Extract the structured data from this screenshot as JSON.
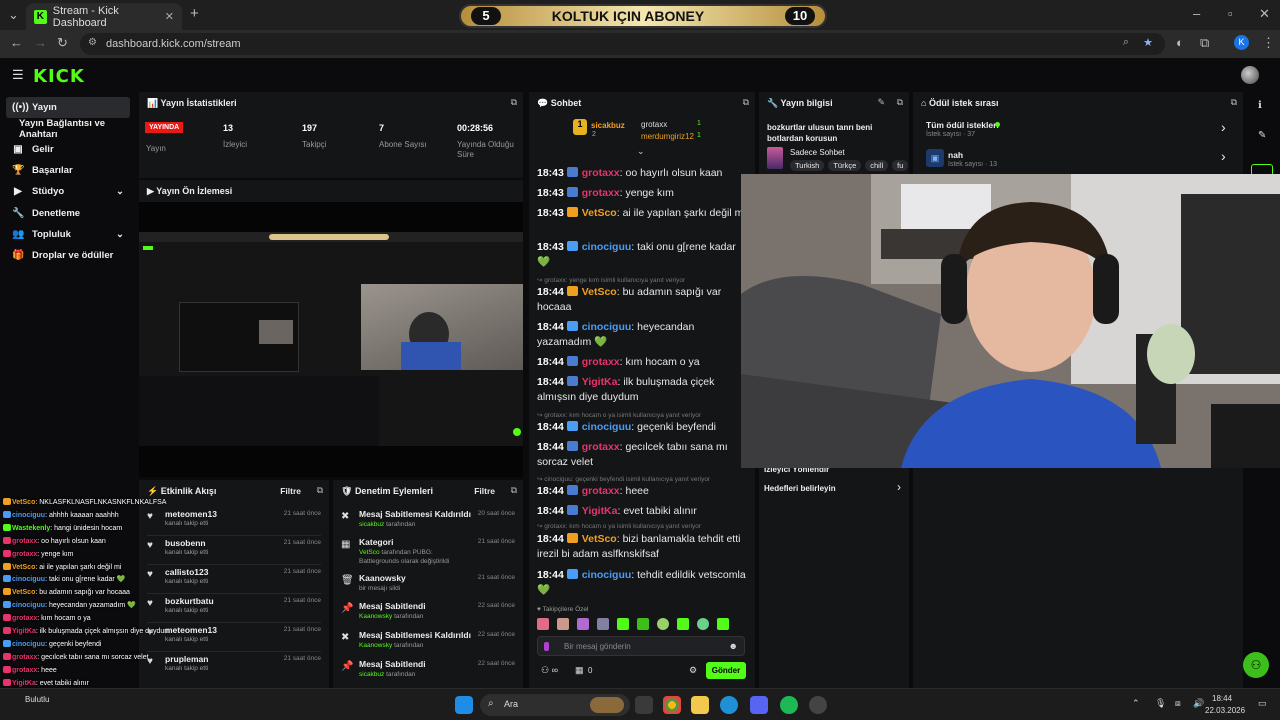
{
  "browser": {
    "tab_title": "Stream - Kick Dashboard",
    "url": "dashboard.kick.com/stream",
    "profile_initial": "K"
  },
  "banner": {
    "left_count": "5",
    "title": "KOLTUK IÇIN ABONEY",
    "right_count": "10"
  },
  "logo": "KICK",
  "sidebar": {
    "items": [
      {
        "label": "Yayın",
        "icon": "broadcast-icon"
      },
      {
        "label": "Yayın Bağlantısı ve Anahtarı",
        "icon": ""
      },
      {
        "label": "Gelir",
        "icon": "revenue-icon"
      },
      {
        "label": "Başarılar",
        "icon": "trophy-icon"
      },
      {
        "label": "Stüdyo",
        "icon": "studio-icon"
      },
      {
        "label": "Denetleme",
        "icon": "wrench-icon"
      },
      {
        "label": "Topluluk",
        "icon": "community-icon"
      },
      {
        "label": "Droplar ve ödüller",
        "icon": "gift-icon"
      }
    ]
  },
  "stats": {
    "title": "Yayın İstatistikleri",
    "live_badge": "YAYINDA",
    "live_label": "Yayın",
    "viewers": "13",
    "viewers_label": "İzleyici",
    "followers": "197",
    "followers_label": "Takipçi",
    "subs": "7",
    "subs_label": "Abone Sayısı",
    "duration": "00:28:56",
    "duration_label": "Yayında Olduğu Süre"
  },
  "preview": {
    "title": "Yayın Ön İzlemesi"
  },
  "activity": {
    "title": "Etkinlik Akışı",
    "filter": "Filtre",
    "items": [
      {
        "name": "meteomen13",
        "sub": "kanalı takip etti",
        "time": "21 saat önce"
      },
      {
        "name": "busobenn",
        "sub": "kanalı takip etti",
        "time": "21 saat önce"
      },
      {
        "name": "callisto123",
        "sub": "kanalı takip etti",
        "time": "21 saat önce"
      },
      {
        "name": "bozkurtbatu",
        "sub": "kanalı takip etti",
        "time": "21 saat önce"
      },
      {
        "name": "meteomen13",
        "sub": "kanalı takip etti",
        "time": "21 saat önce"
      },
      {
        "name": "prupleman",
        "sub": "kanalı takip etti",
        "time": "21 saat önce"
      }
    ]
  },
  "moderation": {
    "title": "Denetim Eylemleri",
    "filter": "Filtre",
    "items": [
      {
        "name": "Mesaj Sabitlemesi Kaldırıldı",
        "user": "sicakbuz",
        "suffix": "tarafından",
        "time": "20 saat önce",
        "extra": ""
      },
      {
        "name": "Kategori",
        "user": "VetSco",
        "suffix": "tarafından",
        "time": "21 saat önce",
        "extra": "PUBG: Battlegrounds olarak değiştirildi"
      },
      {
        "name": "Kaanowsky",
        "user": "",
        "suffix": "bir mesajı sildi",
        "time": "21 saat önce",
        "extra": ""
      },
      {
        "name": "Mesaj Sabitlendi",
        "user": "Kaanowsky",
        "suffix": "tarafından",
        "time": "22 saat önce",
        "extra": ""
      },
      {
        "name": "Mesaj Sabitlemesi Kaldırıldı",
        "user": "Kaanowsky",
        "suffix": "tarafından",
        "time": "22 saat önce",
        "extra": ""
      },
      {
        "name": "Mesaj Sabitlendi",
        "user": "sicakbuz",
        "suffix": "tarafından",
        "time": "22 saat önce",
        "extra": ""
      }
    ]
  },
  "chat": {
    "title": "Sohbet",
    "top": {
      "first": "sicakbuz",
      "first_count": "1",
      "second": "grotaxx",
      "second_count": "2",
      "third": "merdumgiriz12",
      "third_count": "1"
    },
    "messages": [
      {
        "time": "18:43",
        "user": "grotaxx",
        "color": "#e8336b",
        "text": "oo hayırlı olsun kaan",
        "reply": ""
      },
      {
        "time": "18:43",
        "user": "grotaxx",
        "color": "#e8336b",
        "text": "yenge kım",
        "reply": ""
      },
      {
        "time": "18:43",
        "user": "VetSco",
        "color": "#f0a020",
        "text": "ai ile yapılan şarkı değil mi",
        "reply": ""
      },
      {
        "time": "18:43",
        "user": "cinociguu",
        "color": "#4a9df5",
        "text": "taki onu g[rene kadar 💚",
        "reply": ""
      },
      {
        "time": "18:44",
        "user": "VetSco",
        "color": "#f0a020",
        "text": "bu adamın sapığı var hocaaa",
        "reply": "grotaxx: yenge kım isimli kullanıcıya yanıt veriyor"
      },
      {
        "time": "18:44",
        "user": "cinociguu",
        "color": "#4a9df5",
        "text": "heyecandan yazamadım 💚",
        "reply": ""
      },
      {
        "time": "18:44",
        "user": "grotaxx",
        "color": "#e8336b",
        "text": "kım hocam o ya",
        "reply": ""
      },
      {
        "time": "18:44",
        "user": "YigitKa",
        "color": "#e8336b",
        "text": "ilk buluşmada çiçek almışsın diye duydum",
        "reply": ""
      },
      {
        "time": "18:44",
        "user": "cinociguu",
        "color": "#4a9df5",
        "text": "geçenki beyfendi",
        "reply": "grotaxx: kım hocam o ya isimli kullanıcıya yanıt veriyor"
      },
      {
        "time": "18:44",
        "user": "grotaxx",
        "color": "#e8336b",
        "text": "gecılcek tabıı sana mı sorcaz velet",
        "reply": ""
      },
      {
        "time": "18:44",
        "user": "grotaxx",
        "color": "#e8336b",
        "text": "heee",
        "reply": "cinociguu: geçenki beyfendi isimli kullanıcıya yanıt veriyor"
      },
      {
        "time": "18:44",
        "user": "YigitKa",
        "color": "#e8336b",
        "text": "evet tabiki alınır",
        "reply": ""
      },
      {
        "time": "18:44",
        "user": "VetSco",
        "color": "#f0a020",
        "text": "bizi banlamakla tehdit etti irezil bi adam aslfknskifsaf",
        "reply": "grotaxx: kım hocam o ya isimli kullanıcıya yanıt veriyor"
      },
      {
        "time": "18:44",
        "user": "cinociguu",
        "color": "#4a9df5",
        "text": "tehdit edildik vetscomla 💚",
        "reply": ""
      }
    ],
    "followers_only": "Takipçilere Özel",
    "input_placeholder": "Bir mesaj gönderin",
    "points": "0",
    "send": "Gönder"
  },
  "stream_info": {
    "title": "Yayın bilgisi",
    "stream_title": "bozkurtlar ulusun tanrı beni botlardan korusun",
    "category": "Sadece Sohbet",
    "tags": [
      "Turkish",
      "Türkçe",
      "chill",
      "fu"
    ],
    "viewer_directed": "İzleyici Yönlendir",
    "goals": "Hedefleri belirleyin"
  },
  "rewards": {
    "title": "Ödül istek sırası",
    "all_label": "Tüm ödül istekleri",
    "all_count": "İstek sayısı · 37",
    "item_name": "nah",
    "item_count": "İstek sayısı · 13"
  },
  "overlay_chat": [
    {
      "user": "VetSco",
      "color": "#f0a020",
      "text": ": NKLASFKLNASFLNKASNKFLNKALFSA"
    },
    {
      "user": "cinociguu",
      "color": "#4a9df5",
      "text": ": ahhhh kaaaan aaahhh"
    },
    {
      "user": "Wastekenly",
      "color": "#53fc18",
      "text": ": hangi ünidesin hocam"
    },
    {
      "user": "grotaxx",
      "color": "#e8336b",
      "text": ": oo hayırlı olsun kaan"
    },
    {
      "user": "grotaxx",
      "color": "#e8336b",
      "text": ": yenge kım"
    },
    {
      "user": "VetSco",
      "color": "#f0a020",
      "text": ": ai ile yapılan şarkı değil mi"
    },
    {
      "user": "cinociguu",
      "color": "#4a9df5",
      "text": ": taki onu g[rene kadar 💚"
    },
    {
      "user": "VetSco",
      "color": "#f0a020",
      "text": ": bu adamın sapığı var hocaaa"
    },
    {
      "user": "cinociguu",
      "color": "#4a9df5",
      "text": ": heyecandan yazamadım 💚"
    },
    {
      "user": "grotaxx",
      "color": "#e8336b",
      "text": ": kım hocam o ya"
    },
    {
      "user": "YigitKa",
      "color": "#e8336b",
      "text": ": ilk buluşmada çiçek almışsın diye duydum"
    },
    {
      "user": "cinociguu",
      "color": "#4a9df5",
      "text": ": geçenki beyfendi"
    },
    {
      "user": "grotaxx",
      "color": "#e8336b",
      "text": ": gecılcek tabıı sana mı sorcaz velet"
    },
    {
      "user": "grotaxx",
      "color": "#e8336b",
      "text": ": heee"
    },
    {
      "user": "YigitKa",
      "color": "#e8336b",
      "text": ": evet tabiki alınır"
    },
    {
      "user": "VetSco",
      "color": "#f0a020",
      "text": ": bizi banlamakla tehdit etti irezil bi adam aslfknskifsaf"
    },
    {
      "user": "cinociguu",
      "color": "#4a9df5",
      "text": ": tehdit edildik vetscomla 💚"
    }
  ],
  "taskbar": {
    "search": "Ara",
    "time": "18:44",
    "date": "22.03.2026",
    "weather": "Bulutlu"
  },
  "colors": {
    "accent": "#53fc18",
    "panel": "#141517",
    "background": "#0b0b0d"
  }
}
